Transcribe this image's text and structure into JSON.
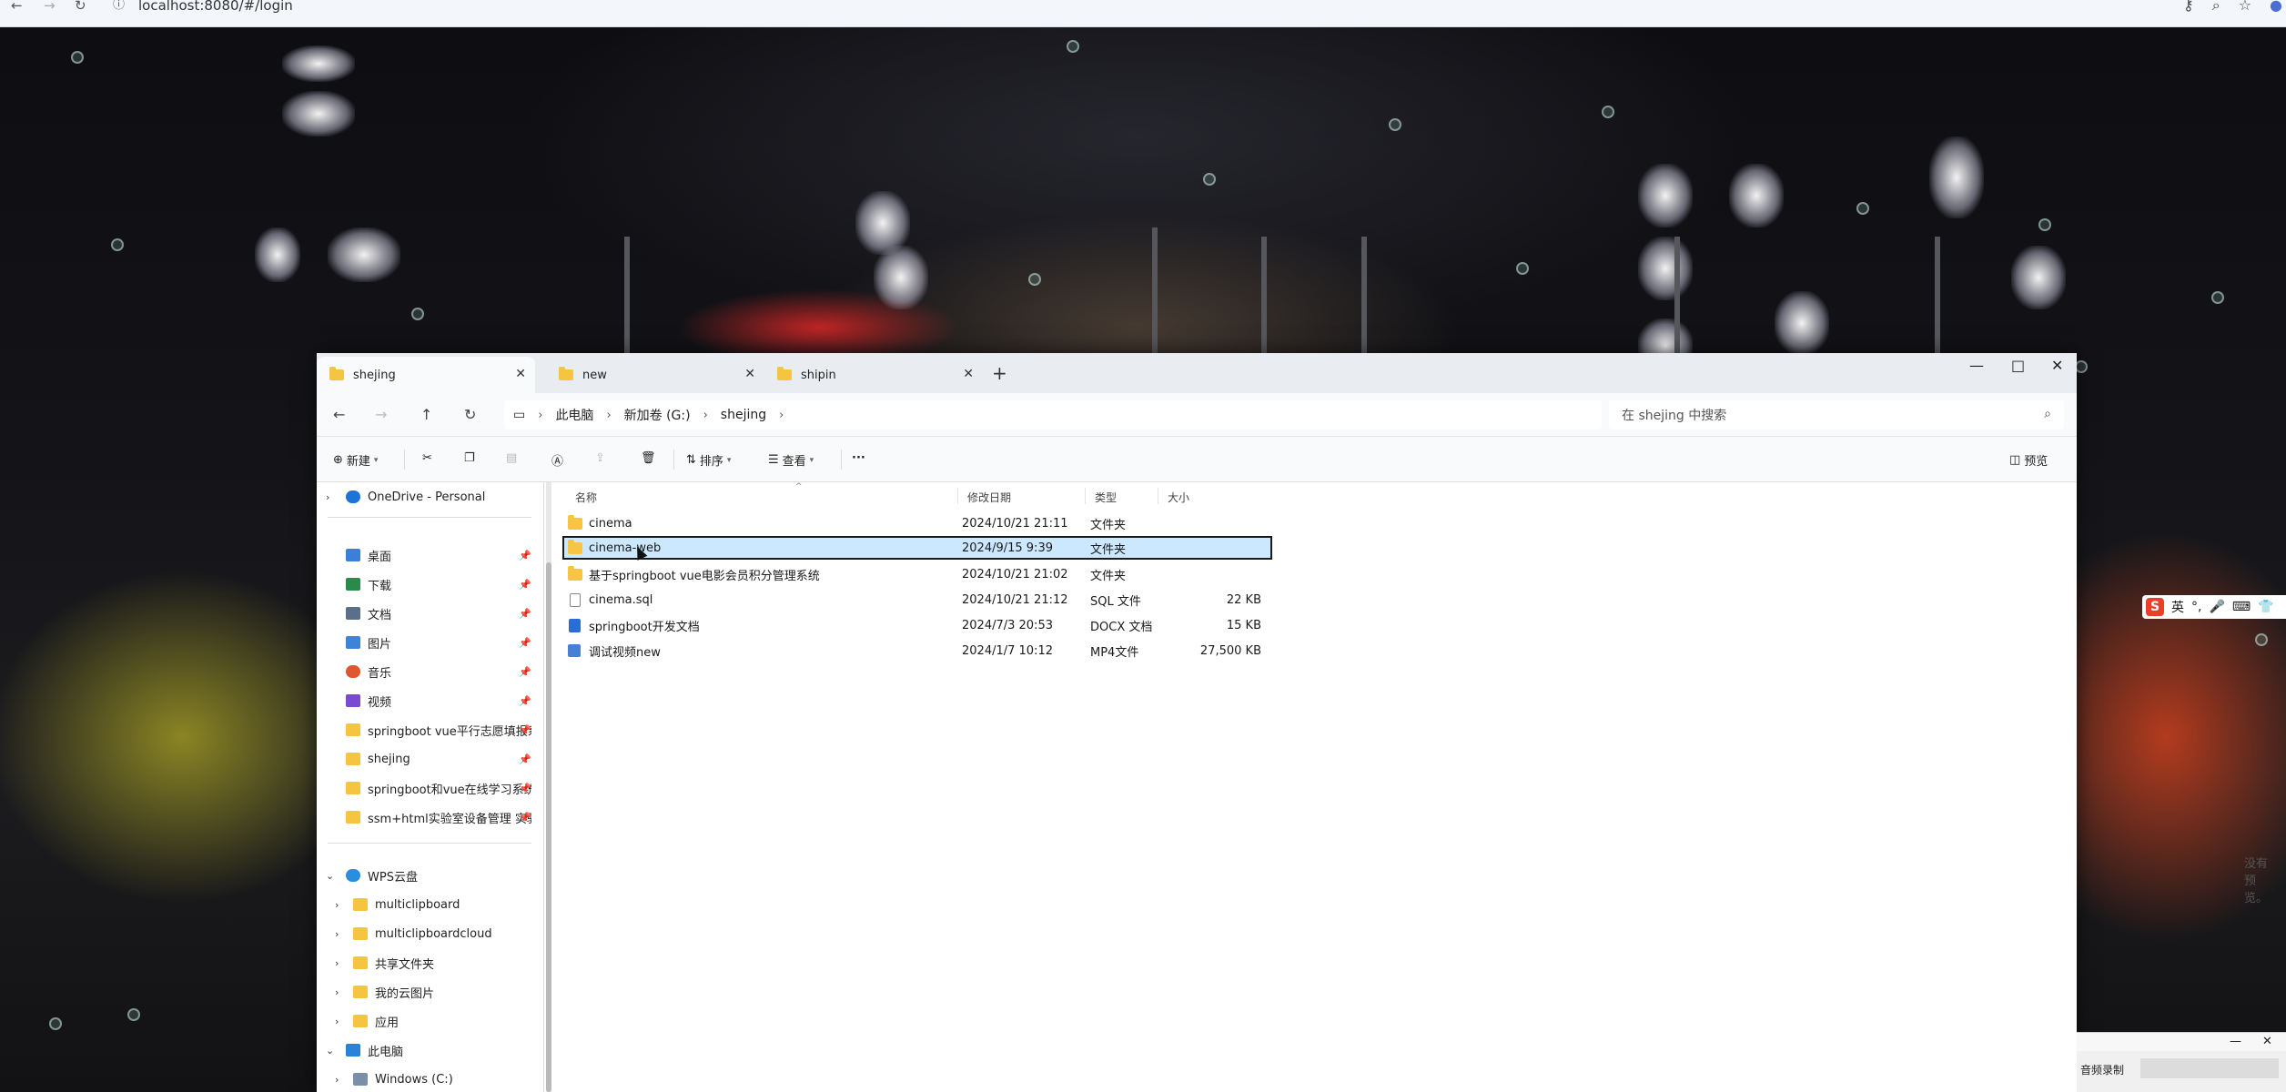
{
  "browser": {
    "url": "localhost:8080/#/login",
    "back_icon": "arrow-left-icon",
    "forward_icon": "arrow-right-icon",
    "reload_icon": "reload-icon"
  },
  "explorer": {
    "tabs": [
      {
        "label": "shejing"
      },
      {
        "label": "new"
      },
      {
        "label": "shipin"
      }
    ],
    "breadcrumb": [
      "此电脑",
      "新加卷 (G:)",
      "shejing"
    ],
    "search_placeholder": "在 shejing 中搜索",
    "toolbar": {
      "new_label": "新建",
      "sort_label": "排序",
      "view_label": "查看",
      "more_label": "···",
      "preview_label": "预览"
    },
    "nav": {
      "onedrive": "OneDrive - Personal",
      "quick_access": [
        {
          "label": "桌面",
          "icon_color": "#3b7fd8"
        },
        {
          "label": "下载",
          "icon_color": "#2a8a4a"
        },
        {
          "label": "文档",
          "icon_color": "#5a6f8a"
        },
        {
          "label": "图片",
          "icon_color": "#3d83d9"
        },
        {
          "label": "音乐",
          "icon_color": "#e0572e"
        },
        {
          "label": "视频",
          "icon_color": "#7a4ad1"
        },
        {
          "label": "springboot vue平行志愿填报系统",
          "icon_color": "#f5c542"
        },
        {
          "label": "shejing",
          "icon_color": "#f5c542"
        },
        {
          "label": "springboot和vue在线学习系统",
          "icon_color": "#f5c542"
        },
        {
          "label": "ssm+html实验室设备管理 实验室",
          "icon_color": "#f5c542"
        }
      ],
      "wps": "WPS云盘",
      "wps_items": [
        "multiclipboard",
        "multiclipboardcloud",
        "共享文件夹",
        "我的云图片",
        "应用"
      ],
      "this_pc": "此电脑",
      "drives": [
        "Windows (C:)"
      ]
    },
    "columns": {
      "name": "名称",
      "date": "修改日期",
      "type": "类型",
      "size": "大小"
    },
    "files": [
      {
        "name": "cinema",
        "date": "2024/10/21 21:11",
        "type": "文件夹",
        "size": "",
        "kind": "folder"
      },
      {
        "name": "cinema-web",
        "date": "2024/9/15 9:39",
        "type": "文件夹",
        "size": "",
        "kind": "folder",
        "selected": true
      },
      {
        "name": "基于springboot vue电影会员积分管理系统",
        "date": "2024/10/21 21:02",
        "type": "文件夹",
        "size": "",
        "kind": "folder"
      },
      {
        "name": "cinema.sql",
        "date": "2024/10/21 21:12",
        "type": "SQL 文件",
        "size": "22 KB",
        "kind": "doc"
      },
      {
        "name": "springboot开发文档",
        "date": "2024/7/3 20:53",
        "type": "DOCX 文档",
        "size": "15 KB",
        "kind": "word"
      },
      {
        "name": "调试视频new",
        "date": "2024/1/7 10:12",
        "type": "MP4文件",
        "size": "27,500 KB",
        "kind": "video"
      }
    ],
    "no_preview": "没有预览。"
  },
  "ime": {
    "logo": "S",
    "mode": "英"
  },
  "recorder": {
    "label": "音频录制"
  },
  "colors": {
    "selection": "#cce8ff",
    "folder": "#f6c544",
    "accent": "#1a73e8"
  }
}
